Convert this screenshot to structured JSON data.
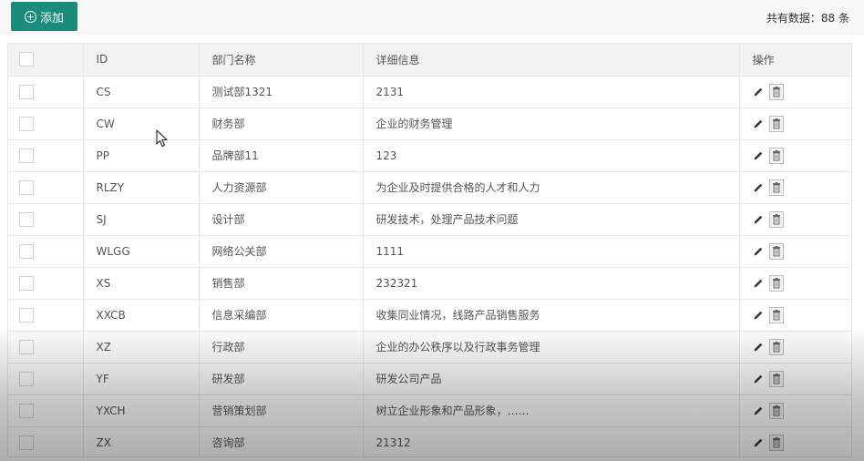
{
  "toolbar": {
    "add_label": "添加",
    "total_text": "共有数据：88 条"
  },
  "table": {
    "headers": [
      "ID",
      "部门名称",
      "详细信息",
      "操作"
    ],
    "rows": [
      {
        "id": "CS",
        "name": "测试部1321",
        "info": "2131"
      },
      {
        "id": "CW",
        "name": "财务部",
        "info": "企业的财务管理"
      },
      {
        "id": "PP",
        "name": "品牌部11",
        "info": "123"
      },
      {
        "id": "RLZY",
        "name": "人力资源部",
        "info": "为企业及时提供合格的人才和人力"
      },
      {
        "id": "SJ",
        "name": "设计部",
        "info": "研发技术，处理产品技术问题"
      },
      {
        "id": "WLGG",
        "name": "网络公关部",
        "info": "1111"
      },
      {
        "id": "XS",
        "name": "销售部",
        "info": "232321"
      },
      {
        "id": "XXCB",
        "name": "信息采编部",
        "info": "收集同业情况，线路产品销售服务"
      },
      {
        "id": "XZ",
        "name": "行政部",
        "info": "企业的办公秩序以及行政事务管理"
      },
      {
        "id": "YF",
        "name": "研发部",
        "info": "研发公司产品"
      },
      {
        "id": "YXCH",
        "name": "营销策划部",
        "info": "树立企业形象和产品形象，……"
      },
      {
        "id": "ZX",
        "name": "咨询部",
        "info": "21312"
      }
    ]
  },
  "colors": {
    "accent": "#1b8c7c",
    "header_bg": "#f2f2f2",
    "border": "#e8e8e8"
  },
  "icons": {
    "add": "plus-circle-icon",
    "edit": "pencil-icon",
    "delete": "trash-icon",
    "pointer": "mouse-cursor-icon"
  }
}
